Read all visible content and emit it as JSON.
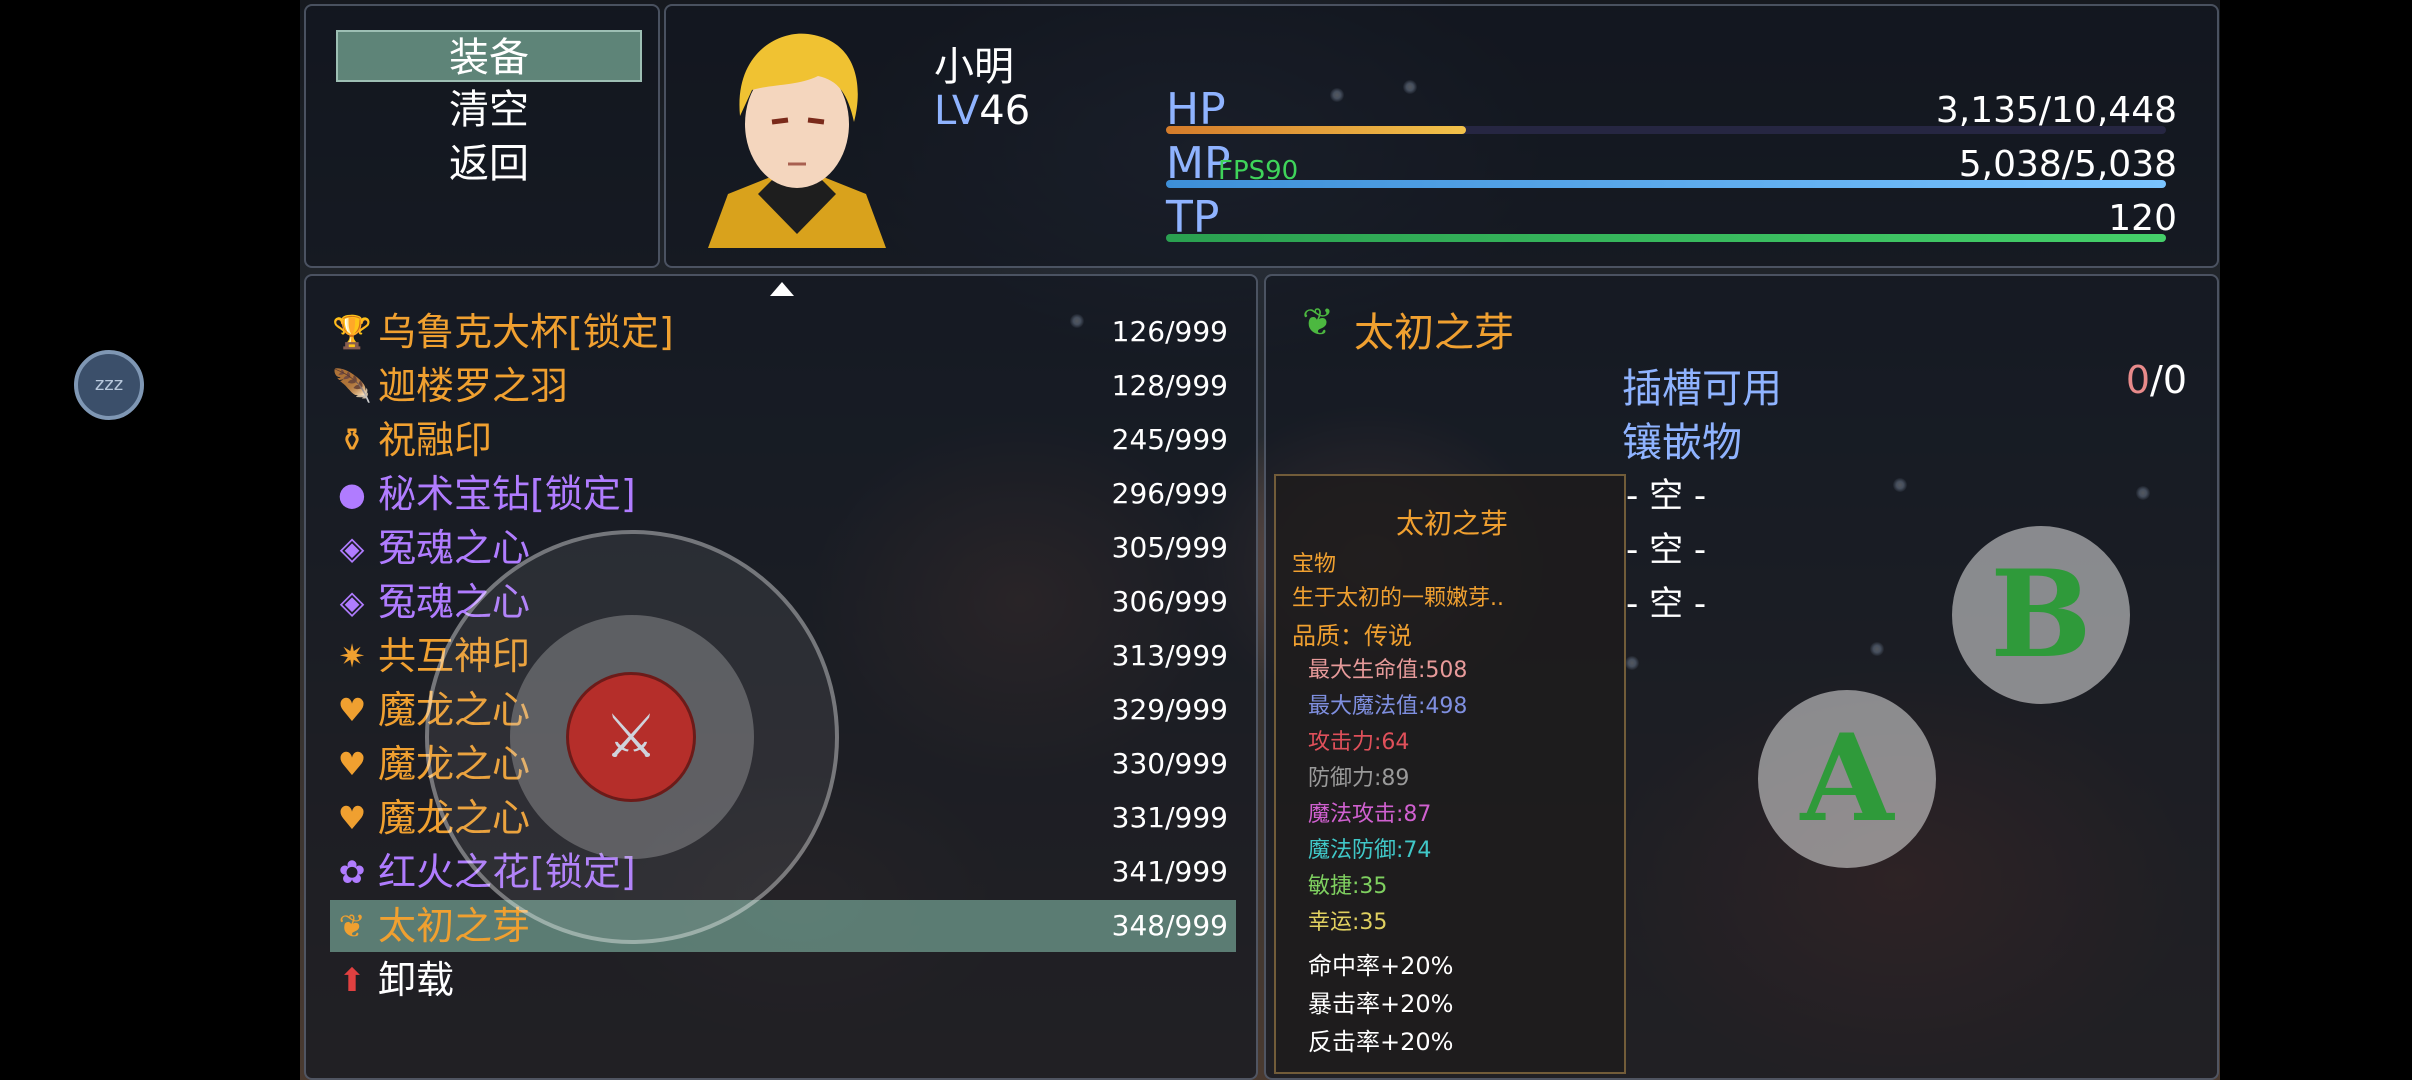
{
  "commands": [
    {
      "label": "装备",
      "selected": true
    },
    {
      "label": "清空",
      "selected": false
    },
    {
      "label": "返回",
      "selected": false
    }
  ],
  "actor": {
    "name": "小明",
    "level_label": "LV",
    "level": "46",
    "hp_label": "HP",
    "hp_text": "3,135/10,448",
    "hp_ratio": 0.3,
    "mp_label": "MP",
    "mp_text": "5,038/5,038",
    "mp_ratio": 1.0,
    "tp_label": "TP",
    "tp_text": "120",
    "tp_ratio": 1.0
  },
  "fps": "FPS90",
  "sleep_badge": "zzz",
  "items": [
    {
      "icon": "🏆",
      "icon_name": "trophy-icon",
      "name": "乌鲁克大杯[锁定]",
      "count": "126/999",
      "color": "#f0a030"
    },
    {
      "icon": "🪶",
      "icon_name": "feather-icon",
      "name": "迦楼罗之羽",
      "count": "128/999",
      "color": "#f0a030"
    },
    {
      "icon": "⚱",
      "icon_name": "seal-icon",
      "name": "祝融印",
      "count": "245/999",
      "color": "#f0a030"
    },
    {
      "icon": "●",
      "icon_name": "gem-icon",
      "name": "秘术宝钻[锁定]",
      "count": "296/999",
      "color": "#b07cff"
    },
    {
      "icon": "◈",
      "icon_name": "soul-heart-icon",
      "name": "冤魂之心",
      "count": "305/999",
      "color": "#b07cff"
    },
    {
      "icon": "◈",
      "icon_name": "soul-heart-icon",
      "name": "冤魂之心",
      "count": "306/999",
      "color": "#b07cff"
    },
    {
      "icon": "✷",
      "icon_name": "mutual-seal-icon",
      "name": "共互神印",
      "count": "313/999",
      "color": "#f0a030"
    },
    {
      "icon": "♥",
      "icon_name": "dragon-heart-icon",
      "name": "魔龙之心",
      "count": "329/999",
      "color": "#f0a030"
    },
    {
      "icon": "♥",
      "icon_name": "dragon-heart-icon",
      "name": "魔龙之心",
      "count": "330/999",
      "color": "#f0a030"
    },
    {
      "icon": "♥",
      "icon_name": "dragon-heart-icon",
      "name": "魔龙之心",
      "count": "331/999",
      "color": "#f0a030"
    },
    {
      "icon": "✿",
      "icon_name": "fire-flower-icon",
      "name": "红火之花[锁定]",
      "count": "341/999",
      "color": "#b07cff"
    },
    {
      "icon": "❦",
      "icon_name": "sprout-icon",
      "name": "太初之芽",
      "count": "348/999",
      "color": "#f0a030",
      "selected": true
    },
    {
      "icon": "⬆",
      "icon_name": "unequip-arrow-icon",
      "name": "卸载",
      "count": "",
      "color": "#ffffff"
    }
  ],
  "detail": {
    "icon": "❦",
    "title": "太初之芽",
    "slots_label": "插槽可用",
    "slots_used": "0",
    "slots_sep": "/0",
    "inlay_label": "镶嵌物",
    "slots": [
      "- 空 -",
      "- 空 -",
      "- 空 -"
    ],
    "tooltip": {
      "name": "太初之芽",
      "type": "宝物",
      "desc": "生于太初的一颗嫩芽..",
      "quality": "品质：传说",
      "stats": [
        {
          "text": "最大生命值:508",
          "color": "#e79a9a"
        },
        {
          "text": "最大魔法值:498",
          "color": "#7f8fe0"
        },
        {
          "text": "攻击力:64",
          "color": "#e0505a"
        },
        {
          "text": "防御力:89",
          "color": "#9a9a9a"
        },
        {
          "text": "魔法攻击:87",
          "color": "#d060d0"
        },
        {
          "text": "魔法防御:74",
          "color": "#40c8c8"
        },
        {
          "text": "敏捷:35",
          "color": "#7fd060"
        },
        {
          "text": "幸运:35",
          "color": "#e0d060"
        }
      ],
      "extras": [
        "命中率+20%",
        "暴击率+20%",
        "反击率+20%"
      ]
    }
  },
  "controls": {
    "a_label": "A",
    "b_label": "B"
  }
}
